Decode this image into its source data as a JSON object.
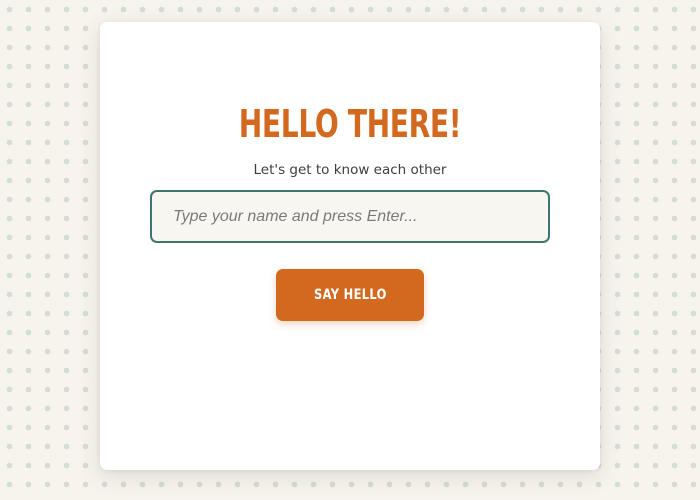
{
  "card": {
    "title": "HELLO THERE!",
    "subtitle": "Let's get to know each other"
  },
  "name_input": {
    "value": "",
    "placeholder": "Type your name and press Enter..."
  },
  "button": {
    "label": "SAY HELLO"
  },
  "colors": {
    "accent": "#d2691e",
    "input_border": "#3f7570",
    "background": "#f7f4ee",
    "dots": "#d3ddd6"
  }
}
